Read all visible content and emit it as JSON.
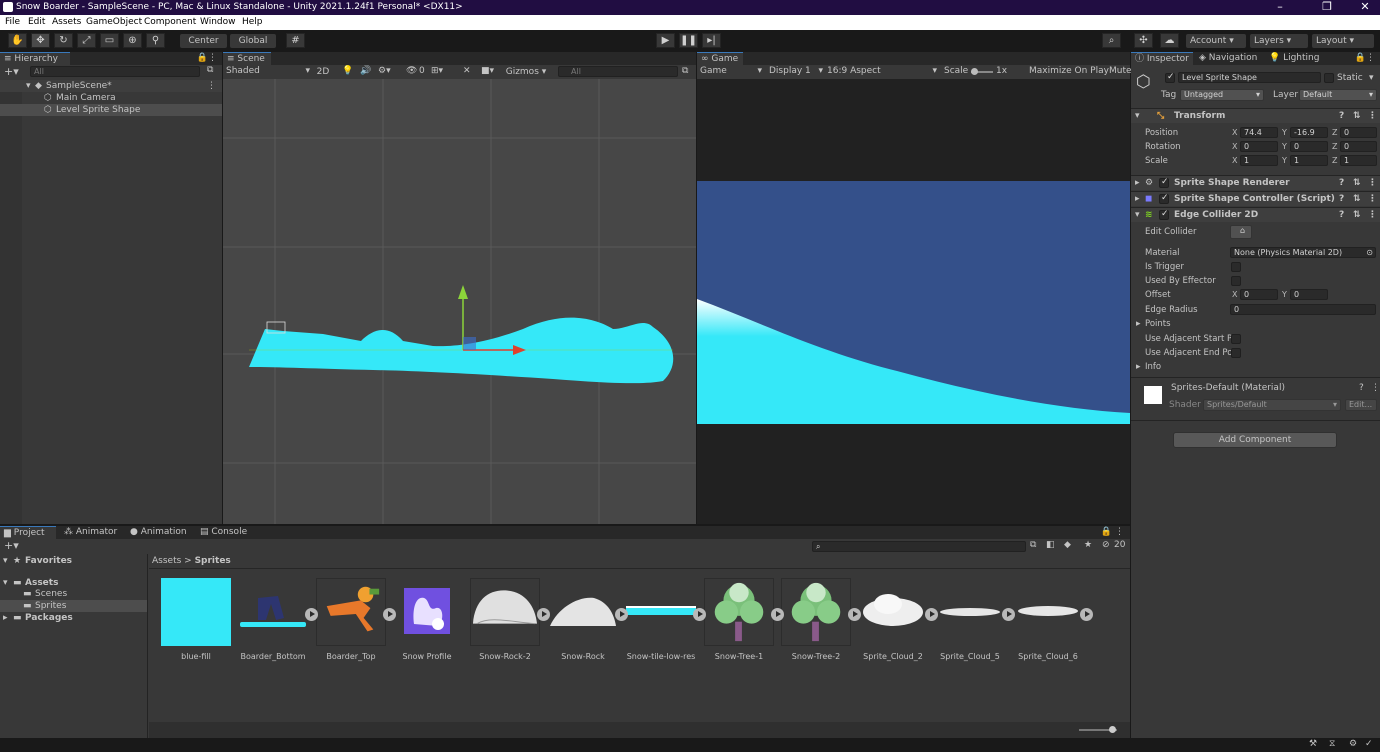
{
  "window": {
    "title": "Snow Boarder - SampleScene - PC, Mac & Linux Standalone - Unity 2021.1.24f1 Personal* <DX11>"
  },
  "menu": [
    "File",
    "Edit",
    "Assets",
    "GameObject",
    "Component",
    "Window",
    "Help"
  ],
  "toolbar": {
    "center": "Center",
    "global": "Global",
    "account": "Account",
    "layers": "Layers",
    "layout": "Layout"
  },
  "hierarchy": {
    "tab": "Hierarchy",
    "search_placeholder": "All",
    "scene": "SampleScene*",
    "items": [
      "Main Camera",
      "Level Sprite Shape"
    ]
  },
  "scene": {
    "tab": "Scene",
    "shading": "Shaded",
    "mode2d": "2D",
    "hidden_count": "0",
    "gizmos": "Gizmos",
    "search_placeholder": "All"
  },
  "game": {
    "tab": "Game",
    "view": "Game",
    "display": "Display 1",
    "aspect": "16:9 Aspect",
    "scale_label": "Scale",
    "scale_value": "1x",
    "maximize": "Maximize On Play",
    "mute": "Mute"
  },
  "inspector": {
    "tabs": [
      "Inspector",
      "Navigation",
      "Lighting"
    ],
    "object_name": "Level Sprite Shape",
    "static_label": "Static",
    "tag_label": "Tag",
    "tag_value": "Untagged",
    "layer_label": "Layer",
    "layer_value": "Default",
    "transform": {
      "title": "Transform",
      "position_label": "Position",
      "rotation_label": "Rotation",
      "scale_label": "Scale",
      "position": {
        "x": "74.4",
        "y": "-16.9",
        "z": "0"
      },
      "rotation": {
        "x": "0",
        "y": "0",
        "z": "0"
      },
      "scale": {
        "x": "1",
        "y": "1",
        "z": "1"
      }
    },
    "components": [
      "Sprite Shape Renderer",
      "Sprite Shape Controller (Script)",
      "Edge Collider 2D"
    ],
    "edge": {
      "edit_collider": "Edit Collider",
      "material_label": "Material",
      "material_value": "None (Physics Material 2D)",
      "is_trigger": "Is Trigger",
      "used_by_effector": "Used By Effector",
      "offset_label": "Offset",
      "offset_x": "0",
      "offset_y": "0",
      "edge_radius_label": "Edge Radius",
      "edge_radius": "0",
      "points": "Points",
      "adj_start": "Use Adjacent Start Po",
      "adj_end": "Use Adjacent End Poi",
      "info": "Info"
    },
    "material": {
      "name": "Sprites-Default (Material)",
      "shader_label": "Shader",
      "shader_value": "Sprites/Default",
      "edit": "Edit..."
    },
    "add_component": "Add Component"
  },
  "bottom_tabs": [
    "Project",
    "Animator",
    "Animation",
    "Console"
  ],
  "project": {
    "favorites": "Favorites",
    "assets": "Assets",
    "scenes": "Scenes",
    "sprites": "Sprites",
    "packages": "Packages",
    "breadcrumb": [
      "Assets",
      "Sprites"
    ],
    "count": "20",
    "assets_list": [
      "blue-fill",
      "Boarder_Bottom",
      "Boarder_Top",
      "Snow Profile",
      "Snow-Rock-2",
      "Snow-Rock",
      "Snow-tile-low-res",
      "Snow-Tree-1",
      "Snow-Tree-2",
      "Sprite_Cloud_2",
      "Sprite_Cloud_5",
      "Sprite_Cloud_6"
    ]
  },
  "colors": {
    "snow": "#35e8f8",
    "sky": "#34508a",
    "accent": "#3a79bb",
    "title_bg": "#210d42"
  }
}
